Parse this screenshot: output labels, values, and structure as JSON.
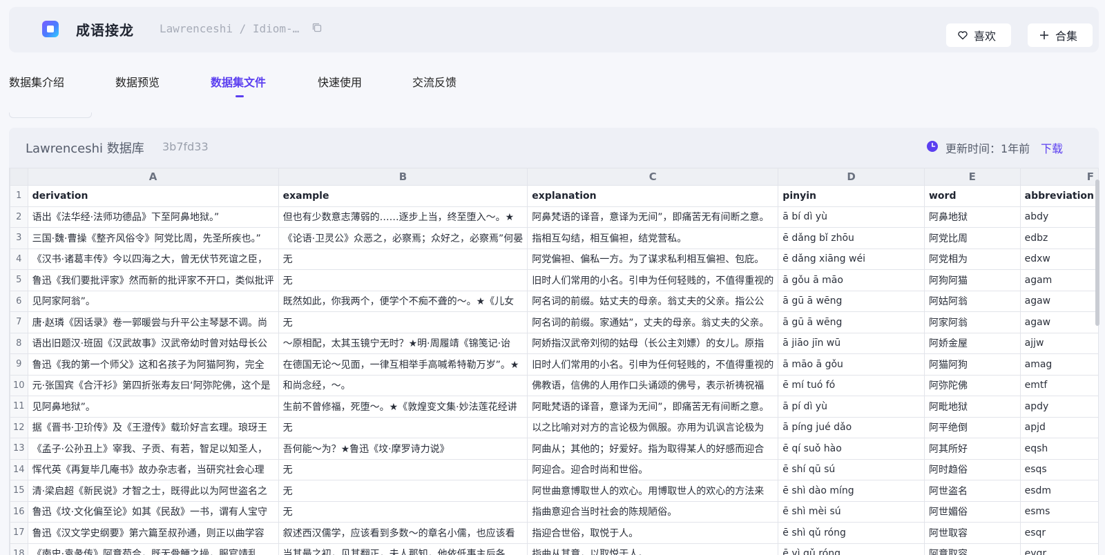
{
  "app": {
    "title": "成语接龙",
    "repo_path": "Lawrenceshi / Idiom-…"
  },
  "header_buttons": {
    "like": "喜欢",
    "collect": "合集"
  },
  "tabs": [
    "数据集介绍",
    "数据预览",
    "数据集文件",
    "快速使用",
    "交流反馈"
  ],
  "active_tab": 2,
  "repo": {
    "name": "Lawrenceshi 数据库",
    "hash": "3b7fd33",
    "update_label": "更新时间：1年前",
    "download": "下载"
  },
  "accent_color": "#5b3ff0",
  "sheet": {
    "col_letters": [
      "A",
      "B",
      "C",
      "D",
      "E",
      "F"
    ],
    "headers": [
      "derivation",
      "example",
      "explanation",
      "pinyin",
      "word",
      "abbreviation"
    ],
    "rows": [
      [
        "语出《法华经·法师功德品》下至阿鼻地狱。”",
        "但也有少数意志薄弱的……逐步上当，终至堕入～。★",
        "阿鼻梵语的译音，意译为无间”，即痛苦无有间断之意。",
        "ā bí dì yù",
        "阿鼻地狱",
        "abdy"
      ],
      [
        "三国·魏·曹操《整齐风俗令》阿党比周，先圣所疾也。”",
        "《论语·卫灵公》众恶之，必察焉；众好之，必察焉”何晏",
        "指相互勾结，相互偏袒，结党营私。",
        "ē dǎng bǐ zhōu",
        "阿党比周",
        "edbz"
      ],
      [
        "《汉书·诸葛丰传》今以四海之大，曾无伏节死谊之臣，",
        "无",
        "阿党偏袒、偏私一方。为了谋求私利相互偏袒、包庇。",
        "ē dǎng xiāng wéi",
        "阿党相为",
        "edxw"
      ],
      [
        "鲁迅《我们要批评家》然而新的批评家不开口，类似批评",
        "无",
        "旧时人们常用的小名。引申为任何轻贱的，不值得重视的",
        "ā gǒu ā māo",
        "阿狗阿猫",
        "agam"
      ],
      [
        "见阿家阿翁”。",
        "既然如此，你我两个，便学个不痴不聋的～。★《儿女",
        "阿名词的前缀。姑丈夫的母亲。翁丈夫的父亲。指公公",
        "ā gū ā wēng",
        "阿姑阿翁",
        "agaw"
      ],
      [
        "唐·赵璘《因话录》卷一郭暖尝与升平公主琴瑟不调。尚",
        "无",
        "阿名词的前缀。家通姑”，丈夫的母亲。翁丈夫的父亲。",
        "ā gū ā wēng",
        "阿家阿翁",
        "agaw"
      ],
      [
        "语出旧题汉·班固《汉武故事》汉武帝幼时曾对姑母长公",
        "～原相配，太其玉镜宁无时？★明·周履靖《锦笺记·诒",
        "阿娇指汉武帝刘彻的姑母（长公主刘嫖）的女儿。原指",
        "ā jiāo jīn wū",
        "阿娇金屋",
        "ajjw"
      ],
      [
        "鲁迅《我的第一个师父》这和名孩子为阿猫阿狗，完全",
        "在德国无论～见面，一律互相举手高喊希特勒万岁”。★",
        "旧时人们常用的小名。引申为任何轻贱的，不值得重视的",
        "ā māo ā gǒu",
        "阿猫阿狗",
        "amag"
      ],
      [
        "元·张国宾《合汗衫》第四折张寿友曰‘阿弥陀佛，这个是",
        "和尚念经，～。",
        "佛教语，信佛的人用作口头诵颂的佛号，表示祈祷祝福",
        "ē mí tuó fó",
        "阿弥陀佛",
        "emtf"
      ],
      [
        "见阿鼻地狱”。",
        "生前不曾修福，死堕～。★《敦煌变文集·妙法莲花经讲",
        "阿毗梵语的译音，意译为无间”，即痛苦无有间断之意。",
        "ā pí dì yù",
        "阿毗地狱",
        "apdy"
      ],
      [
        "据《晋书·卫玠传》及《王澄传》载玠好言玄理。琅玡王",
        "无",
        "以之比喻对对方的言论极为佩服。亦用为讥讽言论极为",
        "ā píng jué dǎo",
        "阿平绝倒",
        "apjd"
      ],
      [
        "《孟子·公孙丑上》宰我、子贡、有若，智足以知圣人，",
        "吾何能～为？★鲁迅《坟·摩罗诗力说》",
        "阿曲从；其他的；好爱好。指为取得某人的好感而迎合",
        "ē qí suǒ hào",
        "阿其所好",
        "eqsh"
      ],
      [
        "恽代英《再复毕几庵书》故办杂志者，当研究社会心理",
        "无",
        "阿迎合。迎合时尚和世俗。",
        "ē shí qū sú",
        "阿时趋俗",
        "esqs"
      ],
      [
        "清·梁启超《新民说》才智之士，既得此以为阿世盗名之",
        "无",
        "阿世曲意博取世人的欢心。用博取世人的欢心的方法来",
        "ē shì dào míng",
        "阿世盗名",
        "esdm"
      ],
      [
        "鲁迅《坟·文化偏至论》如其《民敌》一书，谓有人宝守",
        "无",
        "指曲意迎合当时社会的陈规陋俗。",
        "ē shì mèi sú",
        "阿世媚俗",
        "esms"
      ],
      [
        "鲁迅《汉文学史纲要》第六篇至叔孙通，则正以曲学容",
        "叙述西汉儒学，应该看到多数～的章名小儒，也应该看",
        "指迎合世俗，取悦于人。",
        "ē shì qǔ róng",
        "阿世取容",
        "esqr"
      ],
      [
        "《南史·袁彖传》阿意苟合，既无骨鲠之操，服官靖乱",
        "当其最之初，见其翻正，夫人那知，他依低事主后各",
        "指曲从其意，以取悦于人。",
        "ē yì qǔ róng",
        "阿意取容",
        "eyqr"
      ]
    ]
  }
}
